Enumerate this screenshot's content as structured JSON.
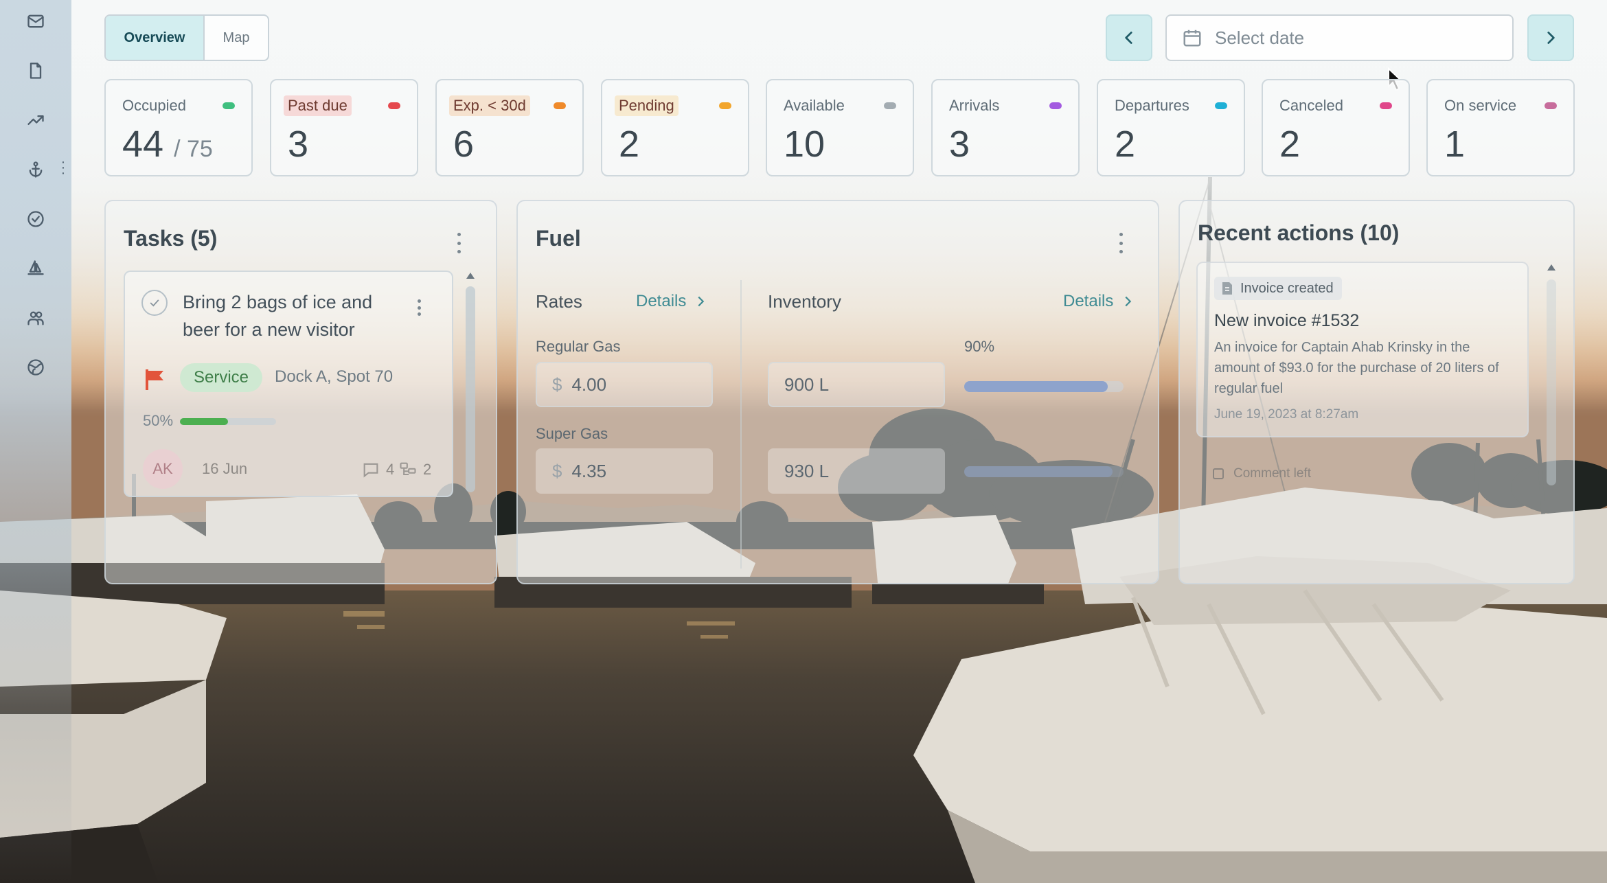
{
  "tabs": [
    {
      "label": "Overview",
      "active": true
    },
    {
      "label": "Map",
      "active": false
    }
  ],
  "date_picker": {
    "placeholder": "Select date",
    "icon": "calendar-icon"
  },
  "sidebar": {
    "icons": [
      "mail-icon",
      "document-icon",
      "trend-icon",
      "anchor-icon",
      "check-circle-icon",
      "boat-icon",
      "users-icon",
      "globe-icon"
    ]
  },
  "stats": [
    {
      "label": "Occupied",
      "value": "44",
      "sub": "/ 75",
      "color": "#3fbf7f"
    },
    {
      "label": "Past due",
      "value": "3",
      "color": "#e5484d",
      "tag_bg": "#f6d9d8"
    },
    {
      "label": "Exp. < 30d",
      "value": "6",
      "color": "#ef8a2a",
      "tag_bg": "#f5e2cf"
    },
    {
      "label": "Pending",
      "value": "2",
      "color": "#f2a52b",
      "tag_bg": "#f7ead0"
    },
    {
      "label": "Available",
      "value": "10",
      "color": "#a3acb2"
    },
    {
      "label": "Arrivals",
      "value": "3",
      "color": "#a35ae0"
    },
    {
      "label": "Departures",
      "value": "2",
      "color": "#1fb0d6"
    },
    {
      "label": "Canceled",
      "value": "2",
      "color": "#e0478a"
    },
    {
      "label": "On service",
      "value": "1",
      "color": "#c76d9c"
    }
  ],
  "tasks": {
    "title": "Tasks (5)",
    "items": [
      {
        "title": "Bring 2 bags of ice and beer for a new visitor",
        "badge": "Service",
        "location": "Dock A, Spot 70",
        "progress_label": "50%",
        "progress": 0.5,
        "avatar": "AK",
        "date": "16 Jun",
        "comments": "4",
        "subtasks": "2"
      }
    ]
  },
  "fuel": {
    "title": "Fuel",
    "rates": {
      "heading": "Rates",
      "details": "Details",
      "items": [
        {
          "label": "Regular Gas",
          "currency": "$",
          "value": "4.00"
        },
        {
          "label": "Super Gas",
          "currency": "$",
          "value": "4.35"
        }
      ]
    },
    "inventory": {
      "heading": "Inventory",
      "details": "Details",
      "items": [
        {
          "value": "900 L",
          "percent_label": "90%",
          "fill": 0.9
        },
        {
          "value": "930 L",
          "fill": 0.93
        }
      ]
    }
  },
  "recent_actions": {
    "title": "Recent actions (10)",
    "items": [
      {
        "tag": "Invoice created",
        "title": "New invoice #1532",
        "description": "An invoice for Captain Ahab Krinsky in the amount of $93.0 for the purchase of 20 liters of regular fuel",
        "time": "June 19, 2023 at 8:27am"
      },
      {
        "tag": "Comment left"
      }
    ]
  }
}
